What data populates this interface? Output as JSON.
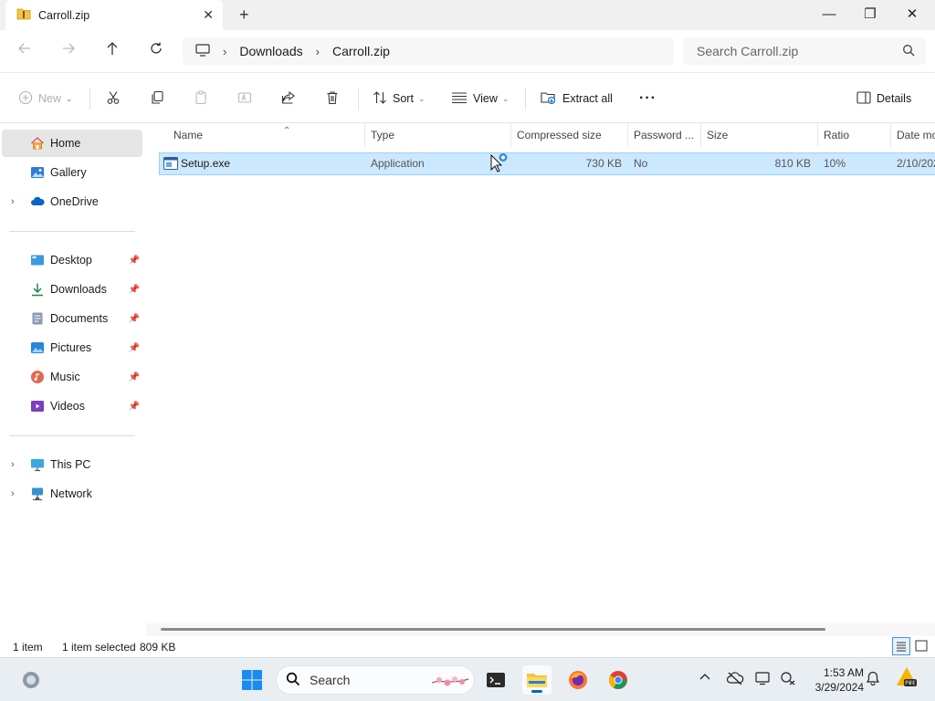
{
  "window": {
    "tab_title": "Carroll.zip",
    "tab_close_glyph": "✕",
    "new_tab_glyph": "+",
    "minimize_glyph": "—",
    "maximize_glyph": "❐",
    "close_glyph": "✕"
  },
  "address": {
    "crumbs": [
      "Downloads",
      "Carroll.zip"
    ],
    "crumb_separator": "›",
    "search_placeholder": "Search Carroll.zip"
  },
  "toolbar": {
    "new_label": "New",
    "sort_label": "Sort",
    "view_label": "View",
    "extract_all_label": "Extract all",
    "more_glyph": "···",
    "details_label": "Details"
  },
  "sidebar": {
    "home": "Home",
    "gallery": "Gallery",
    "onedrive": "OneDrive",
    "quick_access": [
      {
        "label": "Desktop",
        "icon": "desktop-icon"
      },
      {
        "label": "Downloads",
        "icon": "downloads-icon"
      },
      {
        "label": "Documents",
        "icon": "documents-icon"
      },
      {
        "label": "Pictures",
        "icon": "pictures-icon"
      },
      {
        "label": "Music",
        "icon": "music-icon"
      },
      {
        "label": "Videos",
        "icon": "videos-icon"
      }
    ],
    "this_pc": "This PC",
    "network": "Network"
  },
  "columns": [
    "Name",
    "Type",
    "Compressed size",
    "Password ...",
    "Size",
    "Ratio",
    "Date mo"
  ],
  "files": [
    {
      "name": "Setup.exe",
      "type": "Application",
      "compressed_size": "730 KB",
      "password": "No",
      "size": "810 KB",
      "ratio": "10%",
      "date": "2/10/202"
    }
  ],
  "status": {
    "item_count": "1 item",
    "selected": "1 item selected",
    "selected_size": "809 KB"
  },
  "taskbar": {
    "search_label": "Search",
    "time": "1:53 AM",
    "date": "3/29/2024"
  },
  "colors": {
    "selection": "#cce8ff",
    "accent": "#0067c0",
    "folder": "#f4c542"
  }
}
